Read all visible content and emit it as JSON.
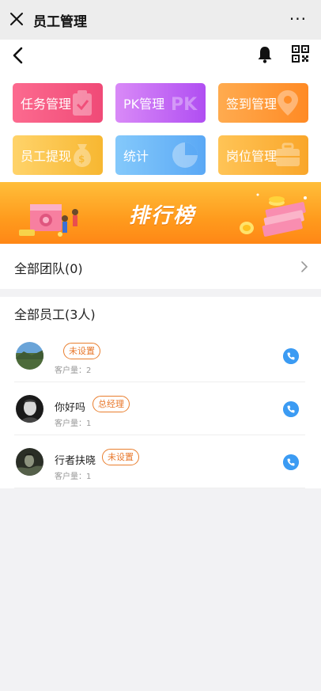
{
  "topbar": {
    "title": "员工管理",
    "more": "···"
  },
  "tiles": [
    {
      "label": "任务管理",
      "icon": "clipboard-icon"
    },
    {
      "label": "PK管理",
      "icon": "pk-icon"
    },
    {
      "label": "签到管理",
      "icon": "location-pin-icon"
    },
    {
      "label": "员工提现",
      "icon": "money-bag-icon"
    },
    {
      "label": "统计",
      "icon": "pie-chart-icon"
    },
    {
      "label": "岗位管理",
      "icon": "briefcase-icon"
    }
  ],
  "banner": {
    "title": "排行榜"
  },
  "team": {
    "label": "全部团队(0)"
  },
  "staff": {
    "header": "全部员工(3人)",
    "rows": [
      {
        "name": "",
        "role": "未设置",
        "customers": "客户量：2"
      },
      {
        "name": "你好吗",
        "role": "总经理",
        "customers": "客户量：1"
      },
      {
        "name": "行者扶晓",
        "role": "未设置",
        "customers": "客户量：1"
      }
    ]
  },
  "colors": {
    "accent_orange": "#ff9b1d",
    "badge": "#e8772a",
    "call": "#3b9bf3"
  }
}
